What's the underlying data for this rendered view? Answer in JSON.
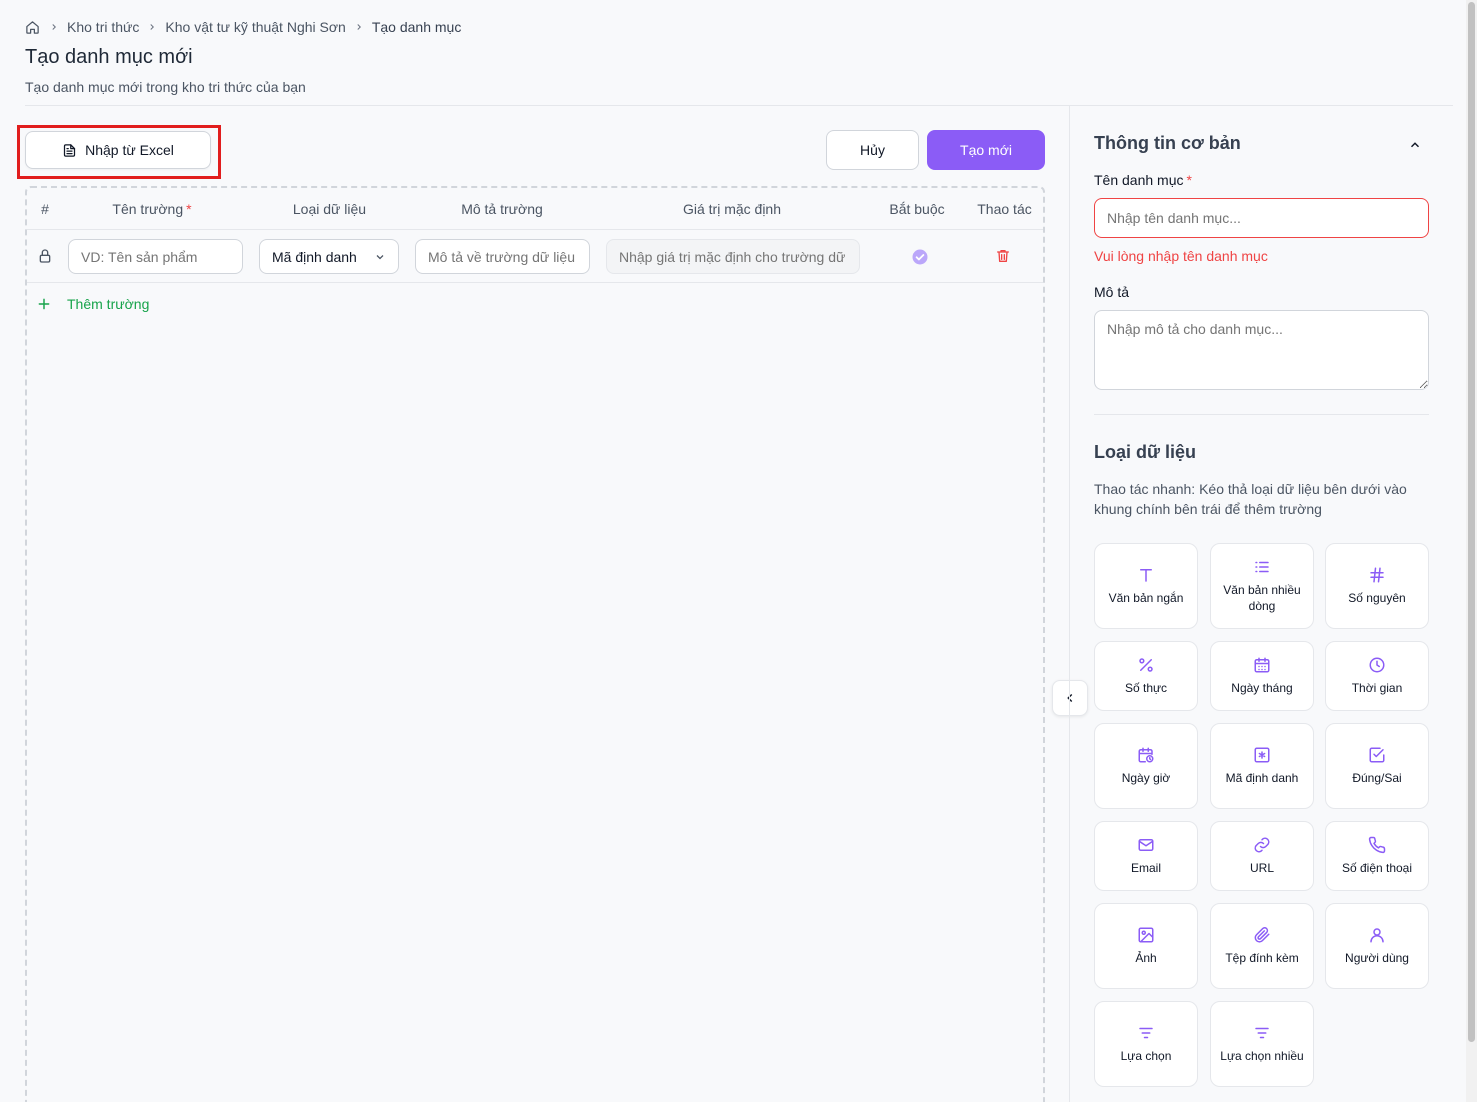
{
  "breadcrumb": {
    "items": [
      "Kho tri thức",
      "Kho vật tư kỹ thuật Nghi Sơn"
    ],
    "current": "Tạo danh mục"
  },
  "header": {
    "title": "Tạo danh mục mới",
    "subtitle": "Tạo danh mục mới trong kho tri thức của bạn"
  },
  "toolbar": {
    "import_label": "Nhập từ Excel",
    "cancel_label": "Hủy",
    "create_label": "Tạo mới"
  },
  "table": {
    "columns": {
      "index": "#",
      "name": "Tên trường",
      "type": "Loại dữ liệu",
      "description": "Mô tả trường",
      "default": "Giá trị mặc định",
      "required": "Bắt buộc",
      "actions": "Thao tác"
    },
    "row": {
      "name_placeholder": "VD: Tên sản phẩm",
      "type_value": "Mã định danh",
      "description_placeholder": "Mô tả về trường dữ liệu",
      "default_placeholder": "Nhập giá trị mặc định cho trường dữ liệu",
      "required": true
    },
    "add_field_label": "Thêm trường"
  },
  "basic_info": {
    "title": "Thông tin cơ bản",
    "name_label": "Tên danh mục",
    "name_placeholder": "Nhập tên danh mục...",
    "name_error": "Vui lòng nhập tên danh mục",
    "description_label": "Mô tả",
    "description_placeholder": "Nhập mô tả cho danh mục..."
  },
  "data_types": {
    "title": "Loại dữ liệu",
    "hint": "Thao tác nhanh: Kéo thả loại dữ liệu bên dưới vào khung chính bên trái để thêm trường",
    "items": [
      {
        "label": "Văn bản ngắn",
        "icon": "text-icon"
      },
      {
        "label": "Văn bản nhiều dòng",
        "icon": "multiline-text-icon"
      },
      {
        "label": "Số nguyên",
        "icon": "hash-icon"
      },
      {
        "label": "Số thực",
        "icon": "percent-icon"
      },
      {
        "label": "Ngày tháng",
        "icon": "calendar-icon"
      },
      {
        "label": "Thời gian",
        "icon": "clock-icon"
      },
      {
        "label": "Ngày giờ",
        "icon": "calendar-clock-icon"
      },
      {
        "label": "Mã định danh",
        "icon": "id-icon"
      },
      {
        "label": "Đúng/Sai",
        "icon": "checkbox-icon"
      },
      {
        "label": "Email",
        "icon": "mail-icon"
      },
      {
        "label": "URL",
        "icon": "link-icon"
      },
      {
        "label": "Số điện thoại",
        "icon": "phone-icon"
      },
      {
        "label": "Ảnh",
        "icon": "image-icon"
      },
      {
        "label": "Tệp đính kèm",
        "icon": "paperclip-icon"
      },
      {
        "label": "Người dùng",
        "icon": "user-icon"
      },
      {
        "label": "Lựa chọn",
        "icon": "select-icon"
      },
      {
        "label": "Lựa chọn nhiều",
        "icon": "multi-select-icon"
      }
    ]
  },
  "colors": {
    "accent": "#8b5cf6",
    "error": "#ef4444",
    "success": "#16a34a",
    "highlight": "#e11d1d"
  }
}
